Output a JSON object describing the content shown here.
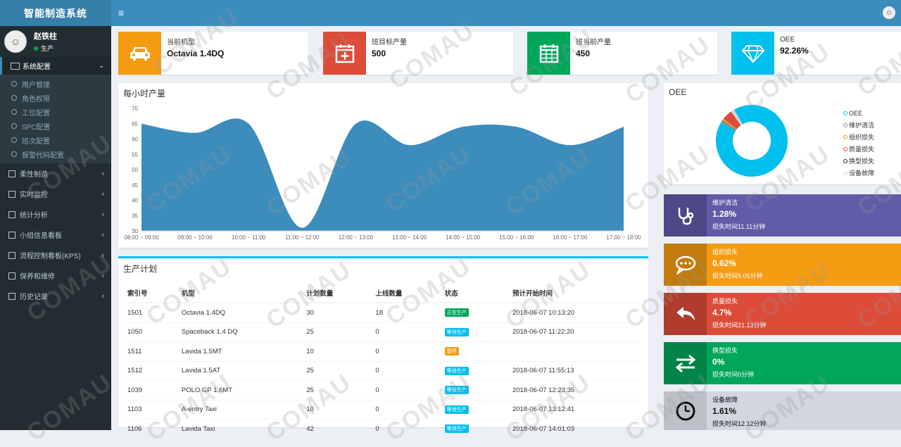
{
  "app": {
    "title": "智能制造系统",
    "menu_icon": "hamburger-icon"
  },
  "user": {
    "name": "赵铁柱",
    "status": "生产"
  },
  "sidebar": {
    "group": {
      "label": "系统配置",
      "items": [
        "用户管理",
        "角色权限",
        "工位配置",
        "SPC配置",
        "班次配置",
        "报警代码配置"
      ]
    },
    "items": [
      "柔性制造",
      "实时监控",
      "统计分析",
      "小组信息看板",
      "流程控制看板(KPS)",
      "保养和维修",
      "历史记录"
    ]
  },
  "infoboxes": [
    {
      "label": "当前机型",
      "value": "Octavia 1.4DQ",
      "color": "#f39c12",
      "icon": "car-icon"
    },
    {
      "label": "班目标产量",
      "value": "500",
      "color": "#dd4b39",
      "icon": "calendar-plus-icon"
    },
    {
      "label": "班当前产量",
      "value": "450",
      "color": "#00a65a",
      "icon": "calendar-icon"
    },
    {
      "label": "OEE",
      "value": "92.26%",
      "color": "#00c0ef",
      "icon": "diamond-icon"
    }
  ],
  "hourly": {
    "title": "每小时产量",
    "chart_data": {
      "type": "area",
      "categories": [
        "08:00 ~ 09:00",
        "09:00 ~ 10:00",
        "10:00 ~ 11:00",
        "11:00 ~ 12:00",
        "12:00 ~ 13:00",
        "13:00 ~ 14:00",
        "14:00 ~ 15:00",
        "15:00 ~ 16:00",
        "16:00 ~ 17:00",
        "17:00 ~ 18:00"
      ],
      "values": [
        65,
        62,
        65,
        31,
        65,
        58,
        64,
        64,
        58,
        64
      ],
      "ylim": [
        30,
        70
      ],
      "yticks": [
        70,
        65,
        60,
        55,
        50,
        45,
        40,
        35,
        30
      ],
      "color": "#3c8dbc"
    }
  },
  "oee": {
    "title": "OEE",
    "chart_data": {
      "type": "pie",
      "categories": [
        "OEE",
        "维护清洁",
        "组织损失",
        "质量损失",
        "换型损失",
        "设备故障"
      ],
      "values": [
        92.26,
        1.28,
        0.62,
        4.7,
        0,
        1.61
      ],
      "colors": [
        "#00c0ef",
        "#7f8c8d",
        "#f39c12",
        "#dd4b39",
        "#222222",
        "#d2d6de"
      ]
    }
  },
  "plan": {
    "title": "生产计划",
    "columns": [
      "索引号",
      "机型",
      "计划数量",
      "上线数量",
      "状态",
      "预计开始时间"
    ],
    "rows": [
      [
        "1501",
        "Octavia 1.4DQ",
        "30",
        "18",
        "正在生产",
        "2018-06-07 10:13:20"
      ],
      [
        "1050",
        "Spaceback 1.4 DQ",
        "25",
        "0",
        "等待生产",
        "2018-06-07 11:22:20"
      ],
      [
        "1511",
        "Lavida 1.5MT",
        "10",
        "0",
        "暂停",
        ""
      ],
      [
        "1512",
        "Lavida 1.5AT",
        "25",
        "0",
        "等待生产",
        "2018-06-07 11:55:13"
      ],
      [
        "1039",
        "POLO GP 1.6MT",
        "25",
        "0",
        "等待生产",
        "2018-06-07 12:23:35"
      ],
      [
        "1103",
        "A-entry Taxi",
        "10",
        "0",
        "等待生产",
        "2018-06-07 13:12:41"
      ],
      [
        "1106",
        "Lavida Taxi",
        "42",
        "0",
        "等待生产",
        "2018-06-07 14:01:03"
      ]
    ],
    "status_colors": {
      "正在生产": "#00a65a",
      "等待生产": "#00c0ef",
      "暂停": "#f39c12"
    }
  },
  "stats": [
    {
      "label": "维护清洁",
      "value": "1.28%",
      "sub": "损失时间11.11分钟",
      "color": "#605ca8",
      "icon": "stethoscope-icon"
    },
    {
      "label": "组织损失",
      "value": "0.62%",
      "sub": "损失时间5.05分钟",
      "color": "#f39c12",
      "icon": "chat-icon"
    },
    {
      "label": "质量损失",
      "value": "4.7%",
      "sub": "损失时间21.13分钟",
      "color": "#dd4b39",
      "icon": "reply-arrow-icon"
    },
    {
      "label": "换型损失",
      "value": "0%",
      "sub": "损失时间0分钟",
      "color": "#00a65a",
      "icon": "exchange-icon"
    },
    {
      "label": "设备故障",
      "value": "1.61%",
      "sub": "损失时间12.12分钟",
      "color": "#d2d6de",
      "icon": "clock-icon"
    }
  ],
  "watermark": "COMAU"
}
